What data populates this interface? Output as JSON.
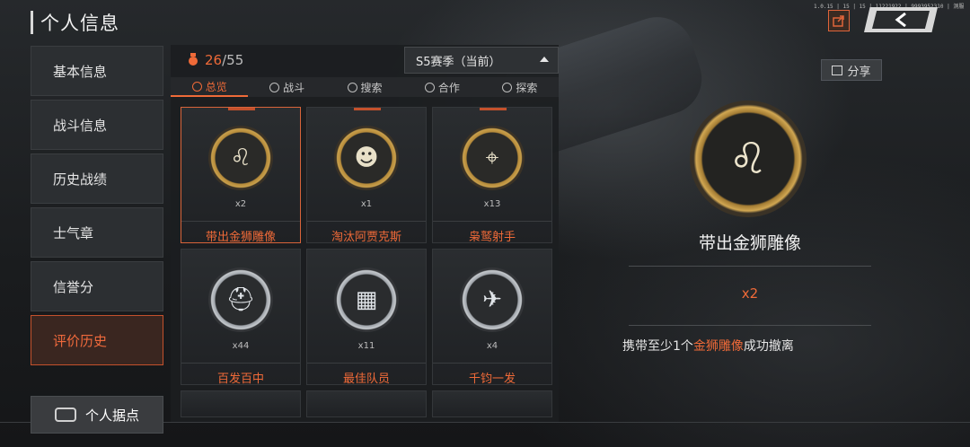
{
  "header": {
    "title": "个人信息",
    "top_id": "1.0.15 | 15 | 15 | 11221922 | 9993952310 | 测服"
  },
  "sidebar": {
    "items": [
      {
        "label": "基本信息"
      },
      {
        "label": "战斗信息"
      },
      {
        "label": "历史战绩"
      },
      {
        "label": "士气章"
      },
      {
        "label": "信誉分"
      },
      {
        "label": "评价历史",
        "active": true
      }
    ],
    "home_label": "个人据点"
  },
  "panel": {
    "count_current": "26",
    "count_total": "/55",
    "season_label": "S5赛季（当前）",
    "tabs": [
      {
        "label": "总览",
        "active": true
      },
      {
        "label": "战斗"
      },
      {
        "label": "搜索"
      },
      {
        "label": "合作"
      },
      {
        "label": "探索"
      }
    ],
    "cards": [
      {
        "name": "带出金狮雕像",
        "qty": "x2",
        "tier": "gold",
        "icon": "lion-icon",
        "glyph": "♌",
        "selected": true
      },
      {
        "name": "淘汰阿贾克斯",
        "qty": "x1",
        "tier": "gold",
        "icon": "soldier-icon",
        "glyph": "☻"
      },
      {
        "name": "枭鹫射手",
        "qty": "x13",
        "tier": "gold",
        "icon": "crosshair-icon",
        "glyph": "⌖"
      },
      {
        "name": "百发百中",
        "qty": "x44",
        "tier": "silver",
        "icon": "helmet-icon",
        "glyph": "⛑"
      },
      {
        "name": "最佳队员",
        "qty": "x11",
        "tier": "silver",
        "icon": "crate-icon",
        "glyph": "▦"
      },
      {
        "name": "千钧一发",
        "qty": "x4",
        "tier": "silver",
        "icon": "runner-icon",
        "glyph": "✈"
      }
    ]
  },
  "detail": {
    "name": "带出金狮雕像",
    "qty": "x2",
    "desc_prefix": "携带至少1个",
    "desc_highlight": "金狮雕像",
    "desc_suffix": "成功撤离",
    "share_label": "分享"
  },
  "colors": {
    "accent": "#ef6a38",
    "gold": "#c9a04c",
    "silver": "#c5c9cd"
  }
}
